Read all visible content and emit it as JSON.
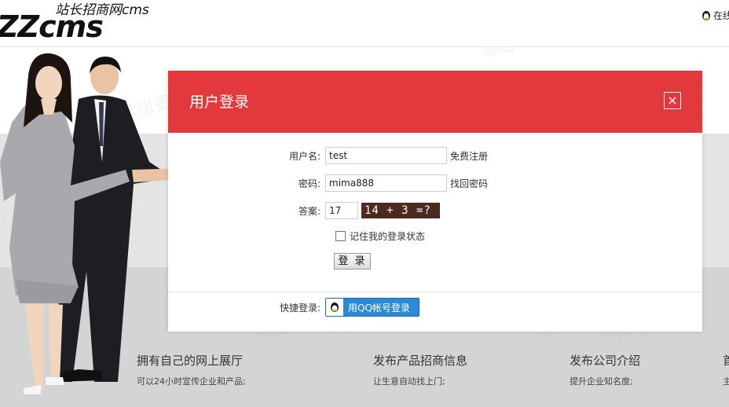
{
  "header": {
    "logo_brand": "ZZcms",
    "logo_slogan": "站长招商网cms",
    "online_service": "在线"
  },
  "dialog": {
    "title": "用户登录",
    "close_symbol": "×",
    "username": {
      "label": "用户名:",
      "value": "test",
      "link": "免费注册"
    },
    "password": {
      "label": "密码:",
      "value": "mima888",
      "link": "找回密码"
    },
    "answer": {
      "label": "答案:",
      "value": "17",
      "captcha_text": "14 + 3 =?"
    },
    "remember_label": "记住我的登录状态",
    "login_button": "登 录",
    "quick_login_label": "快捷登录:",
    "qq_button": "用QQ帐号登录"
  },
  "features": [
    {
      "title": "拥有自己的网上展厅",
      "desc": "可以24小时宣传企业和产品;"
    },
    {
      "title": "发布产品招商信息",
      "desc": "让生意自动找上门;"
    },
    {
      "title": "发布公司介绍",
      "desc": "提升企业知名度;"
    },
    {
      "title": "首",
      "desc": "主"
    }
  ],
  "watermark": "零组资料文库",
  "colors": {
    "accent": "#e4393c",
    "qq_blue": "#2a8ad8"
  }
}
